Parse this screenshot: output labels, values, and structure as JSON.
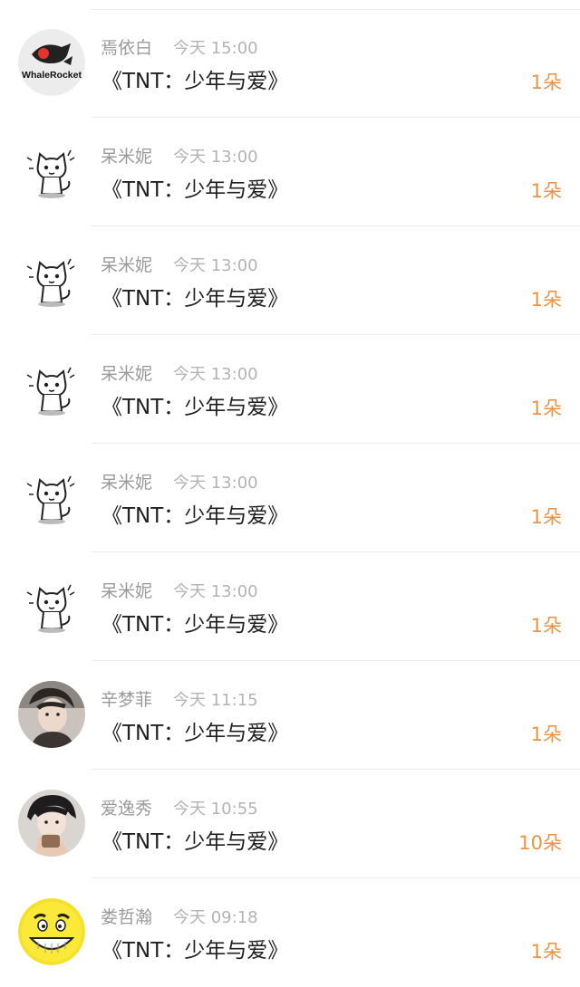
{
  "rows": [
    {
      "name": "焉依白",
      "time": "今天 15:00",
      "title": "《TNT：少年与爱》",
      "count": "1朵",
      "avatar": "whale-rocket-logo",
      "logo_text": "WhaleRocket"
    },
    {
      "name": "呆米妮",
      "time": "今天 13:00",
      "title": "《TNT：少年与爱》",
      "count": "1朵",
      "avatar": "cat-sketch"
    },
    {
      "name": "呆米妮",
      "time": "今天 13:00",
      "title": "《TNT：少年与爱》",
      "count": "1朵",
      "avatar": "cat-sketch"
    },
    {
      "name": "呆米妮",
      "time": "今天 13:00",
      "title": "《TNT：少年与爱》",
      "count": "1朵",
      "avatar": "cat-sketch"
    },
    {
      "name": "呆米妮",
      "time": "今天 13:00",
      "title": "《TNT：少年与爱》",
      "count": "1朵",
      "avatar": "cat-sketch"
    },
    {
      "name": "呆米妮",
      "time": "今天 13:00",
      "title": "《TNT：少年与爱》",
      "count": "1朵",
      "avatar": "cat-sketch"
    },
    {
      "name": "辛梦菲",
      "time": "今天 11:15",
      "title": "《TNT：少年与爱》",
      "count": "1朵",
      "avatar": "person-photo"
    },
    {
      "name": "爱逸秀",
      "time": "今天 10:55",
      "title": "《TNT：少年与爱》",
      "count": "10朵",
      "avatar": "person-photo"
    },
    {
      "name": "娄哲瀚",
      "time": "今天 09:18",
      "title": "《TNT：少年与爱》",
      "count": "1朵",
      "avatar": "smiley-face"
    }
  ],
  "colors": {
    "count": "#f09240",
    "name": "#9a9a9a",
    "time": "#b3b3b3",
    "title": "#1f1f1f",
    "divider": "#ececec"
  }
}
